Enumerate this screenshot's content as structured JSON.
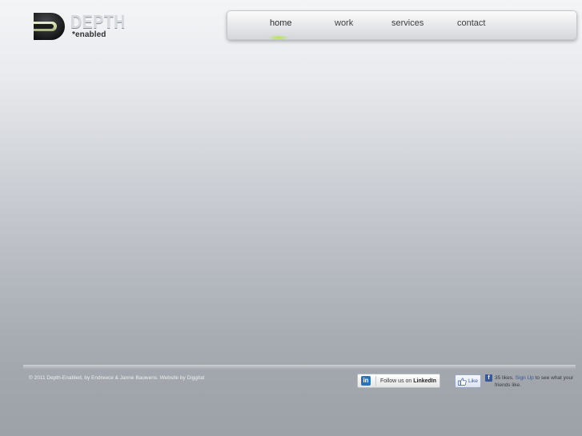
{
  "header": {
    "logo": {
      "word": "DEPTH",
      "tagline": "*enabled"
    }
  },
  "nav": {
    "items": [
      {
        "label": "home",
        "active": true
      },
      {
        "label": "work",
        "active": false
      },
      {
        "label": "services",
        "active": false
      },
      {
        "label": "contact",
        "active": false
      }
    ],
    "accent_color": "#b2e640"
  },
  "footer": {
    "copyright_prefix": "© 2011 Depth-Enabled, by Endreece & Janne Bauwens. Website by ",
    "credit_link": "Diggital",
    "linkedin": {
      "icon": "in",
      "text_prefix": "Follow us on ",
      "text_brand": "LinkedIn"
    },
    "facebook": {
      "like_label": "Like",
      "icon": "f",
      "count_text": "35 likes.",
      "signup_link": "Sign Up",
      "suffix": "to see what your friends like."
    }
  }
}
